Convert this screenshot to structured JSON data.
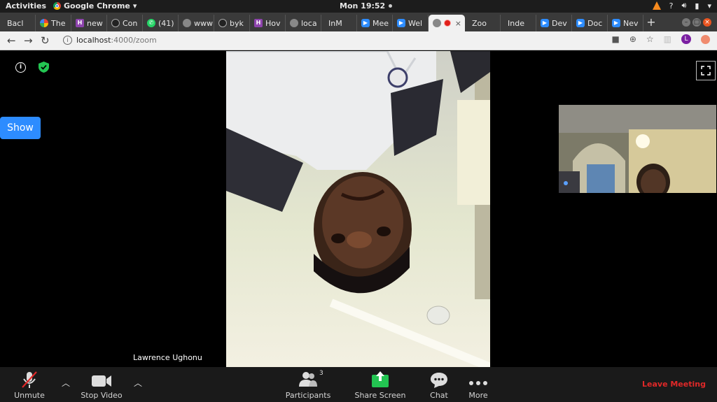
{
  "system_bar": {
    "activities": "Activities",
    "app_name": "Google Chrome",
    "clock": "Mon 19:52"
  },
  "browser": {
    "tabs": [
      {
        "label": "Bacl",
        "favicon": "blank-icon"
      },
      {
        "label": "The",
        "favicon": "google-icon"
      },
      {
        "label": "new",
        "favicon": "hashnode-icon"
      },
      {
        "label": "Con",
        "favicon": "github-icon"
      },
      {
        "label": "(41)",
        "favicon": "whatsapp-icon"
      },
      {
        "label": "www",
        "favicon": "globe-icon"
      },
      {
        "label": "byk",
        "favicon": "github-icon"
      },
      {
        "label": "Hov",
        "favicon": "hashnode-icon"
      },
      {
        "label": "loca",
        "favicon": "globe-icon"
      },
      {
        "label": "InM",
        "favicon": "blank-icon"
      },
      {
        "label": "Mee",
        "favicon": "zoom-icon"
      },
      {
        "label": "Wel",
        "favicon": "zoom-icon"
      },
      {
        "label": "",
        "favicon": "globe-icon",
        "active": true
      },
      {
        "label": "Zoo",
        "favicon": "blank-icon"
      },
      {
        "label": "Inde",
        "favicon": "blank-icon"
      },
      {
        "label": "Dev",
        "favicon": "zoom-icon"
      },
      {
        "label": "Doc",
        "favicon": "zoom-icon"
      },
      {
        "label": "Nev",
        "favicon": "zoom-icon"
      }
    ],
    "url_host": "localhost",
    "url_path": ":4000/zoom"
  },
  "meeting": {
    "show_button": "Show",
    "speaker_name": "Lawrence Ughonu",
    "participants_count": "3",
    "toolbar": {
      "unmute": "Unmute",
      "stop_video": "Stop Video",
      "participants": "Participants",
      "share_screen": "Share Screen",
      "chat": "Chat",
      "more": "More",
      "leave": "Leave Meeting"
    }
  },
  "colors": {
    "zoom_blue": "#2d8cff",
    "share_green": "#23c552",
    "leave_red": "#e02828",
    "security_green": "#23c552"
  }
}
